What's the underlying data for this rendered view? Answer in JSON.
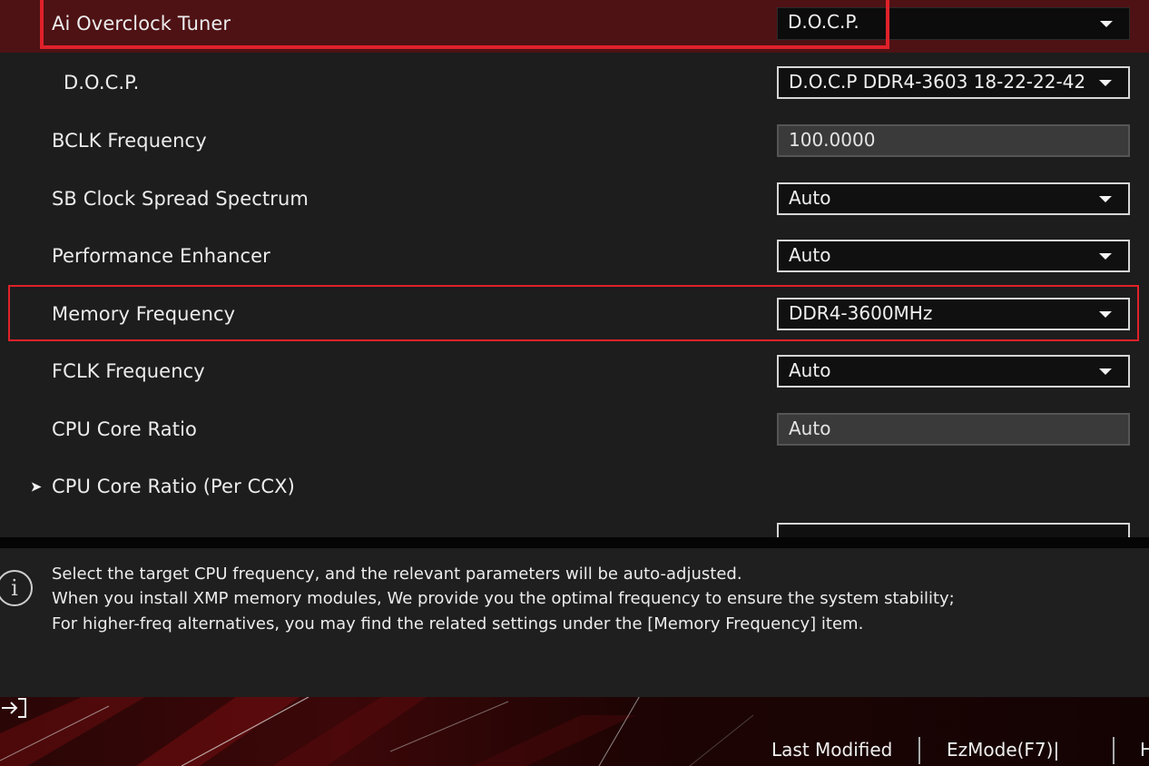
{
  "settings": {
    "ai_overclock_tuner": {
      "label": "Ai Overclock Tuner",
      "value": "D.O.C.P."
    },
    "docp": {
      "label": "D.O.C.P.",
      "value": "D.O.C.P DDR4-3603 18-22-22-42"
    },
    "bclk": {
      "label": "BCLK Frequency",
      "value": "100.0000"
    },
    "sb_spread": {
      "label": "SB Clock Spread Spectrum",
      "value": "Auto"
    },
    "perf_enhancer": {
      "label": "Performance Enhancer",
      "value": "Auto"
    },
    "mem_freq": {
      "label": "Memory Frequency",
      "value": "DDR4-3600MHz"
    },
    "fclk": {
      "label": "FCLK Frequency",
      "value": "Auto"
    },
    "cpu_core_ratio": {
      "label": "CPU Core Ratio",
      "value": "Auto"
    },
    "cpu_core_ratio_ccx": {
      "label": "CPU Core Ratio (Per CCX)",
      "arrow": "➤"
    }
  },
  "help": {
    "icon": "info-icon",
    "lines": [
      "Select the target CPU frequency, and the relevant parameters will be auto-adjusted.",
      "When you install XMP memory modules, We provide you the optimal frequency to ensure the system stability;",
      "For higher-freq alternatives, you may find the related settings under the [Memory Frequency] item."
    ]
  },
  "footer": {
    "last_modified": "Last Modified",
    "ezmode": "EzMode(F7)|",
    "next_item_partial": "H"
  },
  "colors": {
    "highlight_border": "#e0212a",
    "selected_row_bg": "#4e1214",
    "panel_bg": "#1d1d1d"
  }
}
